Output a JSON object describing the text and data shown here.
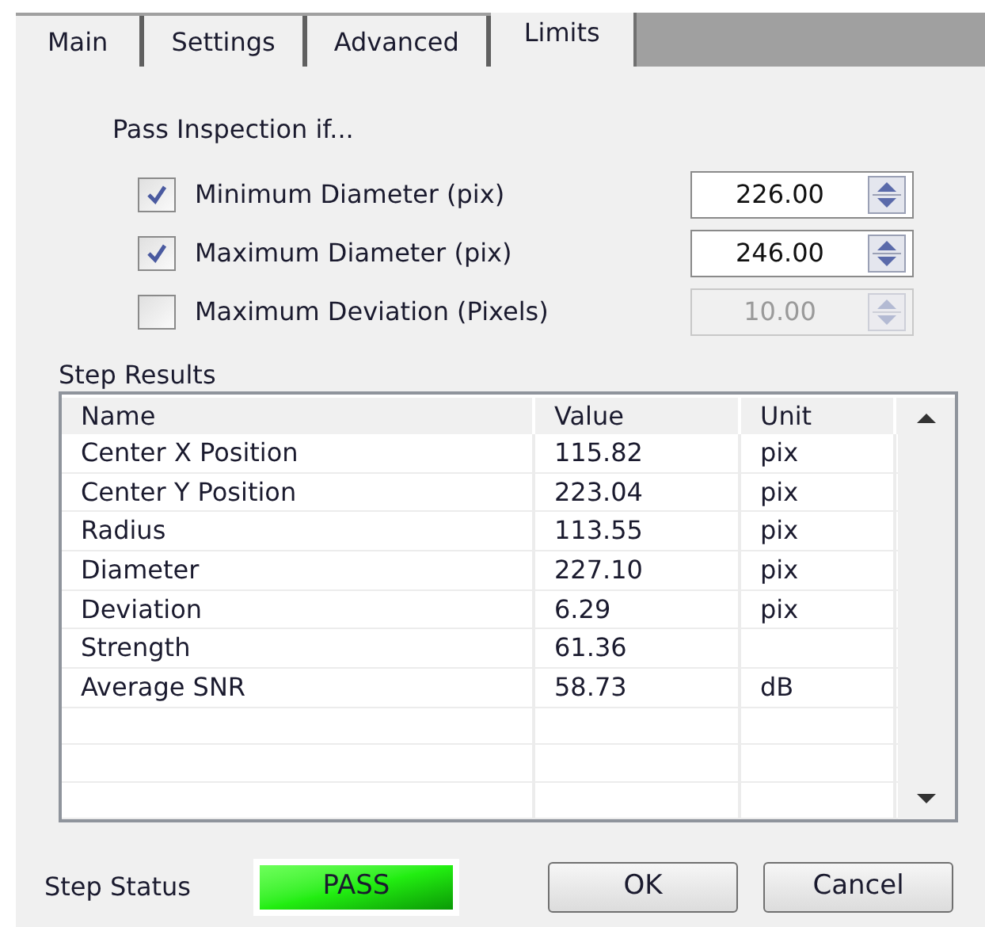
{
  "tabs": [
    {
      "label": "Main",
      "selected": false
    },
    {
      "label": "Settings",
      "selected": false
    },
    {
      "label": "Advanced",
      "selected": false
    },
    {
      "label": "Limits",
      "selected": true
    }
  ],
  "pass_inspection": {
    "heading": "Pass Inspection if...",
    "limits": [
      {
        "label": "Minimum Diameter (pix)",
        "checked": true,
        "value": "226.00"
      },
      {
        "label": "Maximum Diameter (pix)",
        "checked": true,
        "value": "246.00"
      },
      {
        "label": "Maximum Deviation (Pixels)",
        "checked": false,
        "value": "10.00"
      }
    ]
  },
  "step_results": {
    "heading": "Step Results",
    "columns": [
      "Name",
      "Value",
      "Unit"
    ],
    "rows": [
      [
        "Center X Position",
        "115.82",
        "pix"
      ],
      [
        "Center Y Position",
        "223.04",
        "pix"
      ],
      [
        "Radius",
        "113.55",
        "pix"
      ],
      [
        "Diameter",
        "227.10",
        "pix"
      ],
      [
        "Deviation",
        "6.29",
        "pix"
      ],
      [
        "Strength",
        "61.36",
        ""
      ],
      [
        "Average SNR",
        "58.73",
        "dB"
      ]
    ]
  },
  "step_status": {
    "label": "Step Status",
    "value": "PASS",
    "kind": "pass"
  },
  "buttons": [
    "OK",
    "Cancel"
  ]
}
